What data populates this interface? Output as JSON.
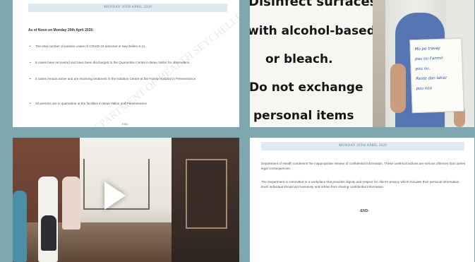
{
  "tiles": [
    {
      "kind": "document",
      "header": "MONDAY 20TH APRIL 2020",
      "lead": "As of Noon on Monday 20th April 2020:",
      "bullets": [
        "The total number of positive cases of COVID-19 detected in Seychelles is 11",
        "6 cases have recovered and have been discharged to the Quarantine Centre in Beau Vallon for observation.",
        "5 cases remain active and are receiving treatment in the isolation Centre at the Family Hospital in Perseverance",
        "16 persons are in quarantine at the facilities in Beau Vallon and Perseverance"
      ],
      "watermark": "DEPARTMENT OF HEALTH SEYCHELLES",
      "footer": "END"
    },
    {
      "kind": "photo",
      "poster_lines": [
        "Disinfect surfaces",
        "with alcohol-based",
        "or bleach.",
        "Do not exchange",
        "personal items"
      ],
      "sign_lines": [
        "Mo pe travay",
        "pou ou Fanmir",
        "pou ou,",
        "Reste dan lakaz",
        "pou nou"
      ]
    },
    {
      "kind": "video",
      "play_label": "Play video"
    },
    {
      "kind": "document",
      "header": "MONDAY 20TH APRIL 2020",
      "paragraphs": [
        "Department of Health condemns the inappropriate release of confidential information. These unethical actions are serious offences that carries legal consequences.",
        "The Department is committed to a workplace that provides dignity and respect for client's privacy which includes their personal information. Each individual should act humanely and refrain from sharing confidential information."
      ],
      "footer": "-END-"
    }
  ],
  "colors": {
    "background": "#7fa7b0",
    "header_bar": "#dfe9f2",
    "sign_ink": "#2a4fa0",
    "scrubs": "#5576b3"
  }
}
